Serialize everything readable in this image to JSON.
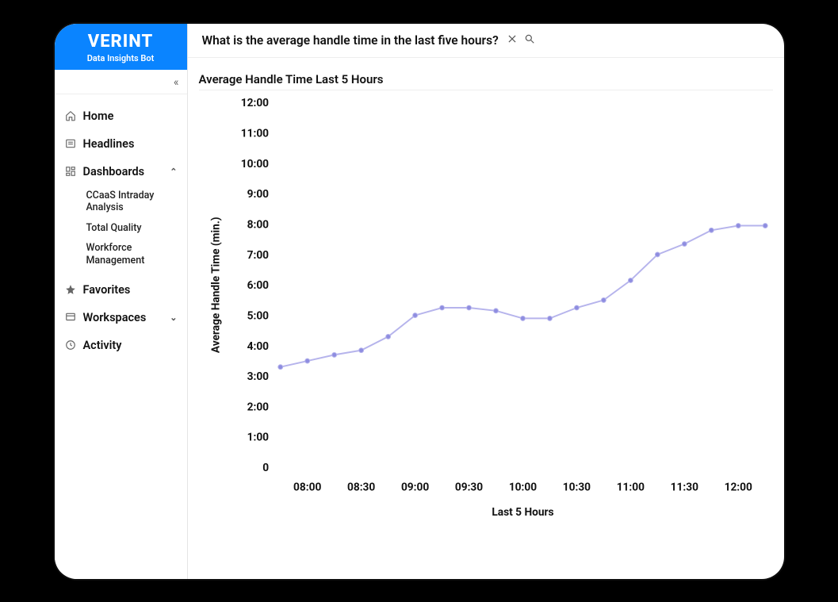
{
  "brand": {
    "name": "VERINT",
    "subtitle": "Data Insights Bot"
  },
  "sidebar": {
    "items": [
      {
        "icon": "home-icon",
        "label": "Home"
      },
      {
        "icon": "news-icon",
        "label": "Headlines"
      },
      {
        "icon": "dashboard-icon",
        "label": "Dashboards",
        "expanded": true,
        "children": [
          "CCaaS Intraday Analysis",
          "Total Quality",
          "Workforce Management"
        ]
      },
      {
        "icon": "star-icon",
        "label": "Favorites"
      },
      {
        "icon": "workspace-icon",
        "label": "Workspaces",
        "expandable": true
      },
      {
        "icon": "activity-icon",
        "label": "Activity"
      }
    ]
  },
  "query": {
    "text": "What is the average handle time in the last five hours?"
  },
  "chart": {
    "title": "Average Handle Time Last 5 Hours",
    "ylabel": "Average Handle Time (min.)",
    "xlabel": "Last 5 Hours",
    "yaxis": [
      "12:00",
      "11:00",
      "10:00",
      "9:00",
      "8:00",
      "7:00",
      "6:00",
      "5:00",
      "4:00",
      "3:00",
      "2:00",
      "1:00",
      "0"
    ],
    "xaxis": [
      "08:00",
      "08:30",
      "09:00",
      "09:30",
      "10:00",
      "10:30",
      "11:00",
      "11:30",
      "12:00"
    ]
  },
  "chart_data": {
    "type": "line",
    "title": "Average Handle Time Last 5 Hours",
    "xlabel": "Last 5 Hours",
    "ylabel": "Average Handle Time (min.)",
    "ylim": [
      0,
      12
    ],
    "x": [
      "07:45",
      "08:00",
      "08:15",
      "08:30",
      "08:45",
      "09:00",
      "09:15",
      "09:30",
      "09:45",
      "10:00",
      "10:15",
      "10:30",
      "10:45",
      "11:00",
      "11:15",
      "11:30",
      "11:45",
      "12:00",
      "12:15"
    ],
    "values": [
      3.3,
      3.5,
      3.7,
      3.85,
      4.3,
      5.0,
      5.25,
      5.25,
      5.15,
      4.9,
      4.9,
      5.25,
      5.5,
      6.15,
      7.0,
      7.35,
      7.8,
      7.95,
      7.95
    ]
  }
}
